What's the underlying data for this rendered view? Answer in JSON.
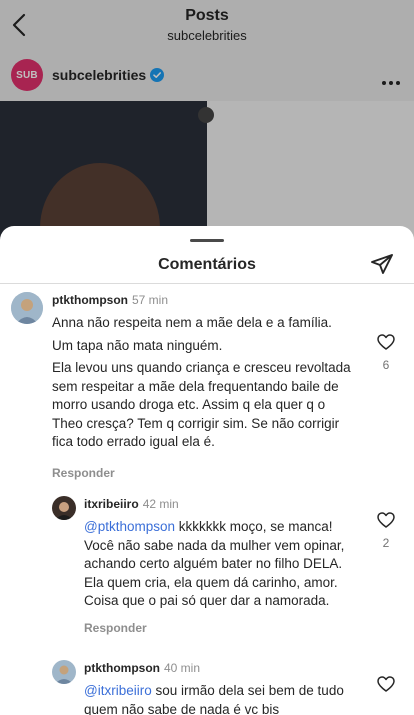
{
  "header": {
    "title": "Posts",
    "subtitle": "subcelebrities"
  },
  "post": {
    "avatar_text": "SUB",
    "username": "subcelebrities",
    "brand_color": "#e1306c"
  },
  "sheet": {
    "title": "Comentários"
  },
  "comments": [
    {
      "username": "ptkthompson",
      "time": "57 min",
      "paragraphs": [
        "Anna não respeita nem a mãe dela e a família.",
        "Um tapa não mata ninguém.",
        "Ela levou uns quando criança e cresceu revoltada sem respeitar a mãe dela frequentando baile de morro usando droga etc. Assim q ela quer q o Theo cresça? Tem q corrigir sim. Se não corrigir fica todo errado igual ela é."
      ],
      "reply_label": "Responder",
      "likes": "6"
    },
    {
      "username": "itxribeiiro",
      "time": "42 min",
      "mention": "@ptkthompson",
      "text": " kkkkkkk moço, se manca! Você não sabe nada da mulher vem opinar, achando certo alguém bater no filho DELA. Ela quem cria, ela quem dá carinho, amor. Coisa que o pai só quer dar a namorada.",
      "reply_label": "Responder",
      "likes": "2"
    },
    {
      "username": "ptkthompson",
      "time": "40 min",
      "mention": "@itxribeiiro",
      "text": " sou irmão dela sei bem de tudo quem não sabe de nada é vc bis"
    }
  ],
  "icons": {
    "back": "back-arrow-icon",
    "verified": "verified-badge-icon",
    "more": "more-options-icon",
    "share": "share-icon",
    "like": "heart-icon"
  },
  "colors": {
    "mention": "#3b6fd8",
    "verified": "#1d9bf0",
    "secondary_text": "#8e8e8e"
  }
}
